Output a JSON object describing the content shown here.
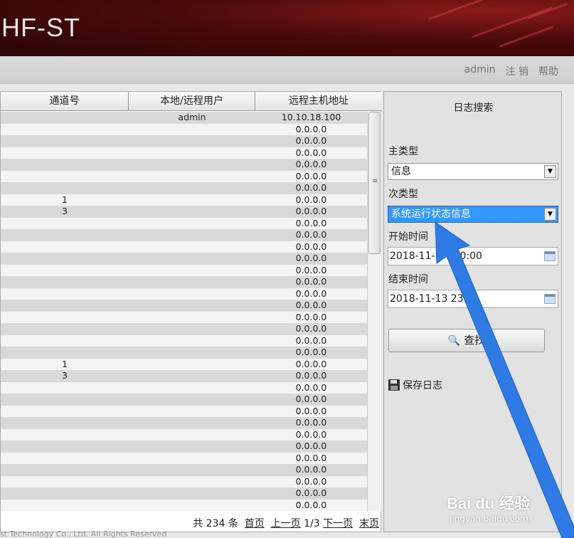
{
  "header": {
    "title": "HF-ST"
  },
  "nav": {
    "user": "admin",
    "logout": "注 销",
    "help": "帮助"
  },
  "table": {
    "columns": [
      "通道号",
      "本地/远程用户",
      "远程主机地址"
    ],
    "rows": [
      {
        "chan": "",
        "user": "admin",
        "addr": "10.10.18.100"
      },
      {
        "chan": "",
        "user": "",
        "addr": "0.0.0.0"
      },
      {
        "chan": "",
        "user": "",
        "addr": "0.0.0.0"
      },
      {
        "chan": "",
        "user": "",
        "addr": "0.0.0.0"
      },
      {
        "chan": "",
        "user": "",
        "addr": "0.0.0.0"
      },
      {
        "chan": "",
        "user": "",
        "addr": "0.0.0.0"
      },
      {
        "chan": "",
        "user": "",
        "addr": "0.0.0.0"
      },
      {
        "chan": "1",
        "user": "",
        "addr": "0.0.0.0"
      },
      {
        "chan": "3",
        "user": "",
        "addr": "0.0.0.0"
      },
      {
        "chan": "",
        "user": "",
        "addr": "0.0.0.0"
      },
      {
        "chan": "",
        "user": "",
        "addr": "0.0.0.0"
      },
      {
        "chan": "",
        "user": "",
        "addr": "0.0.0.0"
      },
      {
        "chan": "",
        "user": "",
        "addr": "0.0.0.0"
      },
      {
        "chan": "",
        "user": "",
        "addr": "0.0.0.0"
      },
      {
        "chan": "",
        "user": "",
        "addr": "0.0.0.0"
      },
      {
        "chan": "",
        "user": "",
        "addr": "0.0.0.0"
      },
      {
        "chan": "",
        "user": "",
        "addr": "0.0.0.0"
      },
      {
        "chan": "",
        "user": "",
        "addr": "0.0.0.0"
      },
      {
        "chan": "",
        "user": "",
        "addr": "0.0.0.0"
      },
      {
        "chan": "",
        "user": "",
        "addr": "0.0.0.0"
      },
      {
        "chan": "",
        "user": "",
        "addr": "0.0.0.0"
      },
      {
        "chan": "1",
        "user": "",
        "addr": "0.0.0.0"
      },
      {
        "chan": "3",
        "user": "",
        "addr": "0.0.0.0"
      },
      {
        "chan": "",
        "user": "",
        "addr": "0.0.0.0"
      },
      {
        "chan": "",
        "user": "",
        "addr": "0.0.0.0"
      },
      {
        "chan": "",
        "user": "",
        "addr": "0.0.0.0"
      },
      {
        "chan": "",
        "user": "",
        "addr": "0.0.0.0"
      },
      {
        "chan": "",
        "user": "",
        "addr": "0.0.0.0"
      },
      {
        "chan": "",
        "user": "",
        "addr": "0.0.0.0"
      },
      {
        "chan": "",
        "user": "",
        "addr": "0.0.0.0"
      },
      {
        "chan": "",
        "user": "",
        "addr": "0.0.0.0"
      },
      {
        "chan": "",
        "user": "",
        "addr": "0.0.0.0"
      },
      {
        "chan": "",
        "user": "",
        "addr": "0.0.0.0"
      },
      {
        "chan": "",
        "user": "",
        "addr": "0.0.0.0"
      }
    ]
  },
  "pager": {
    "total": "共 234 条",
    "first": "首页",
    "prev": "上一页",
    "page": "1/3",
    "next": "下一页",
    "last": "末页"
  },
  "footer": {
    "copyright": "st Technology Co., Ltd. All Rights Reserved"
  },
  "search": {
    "title": "日志搜索",
    "main_type_label": "主类型",
    "main_type_value": "信息",
    "sub_type_label": "次类型",
    "sub_type_value": "系统运行状态信息",
    "start_label": "开始时间",
    "start_value": "2018-11-1",
    "start_value_tail": "0:00",
    "end_label": "结束时间",
    "end_value": "2018-11-13 23:5",
    "search_button": "查找",
    "save_log": "保存日志"
  },
  "watermark": {
    "main": "Bai du 经验",
    "sub": "jingyan.baidu.com"
  },
  "colors": {
    "banner": "#4a0a0a",
    "highlight": "#3399ff",
    "arrow": "#2f7be6"
  }
}
